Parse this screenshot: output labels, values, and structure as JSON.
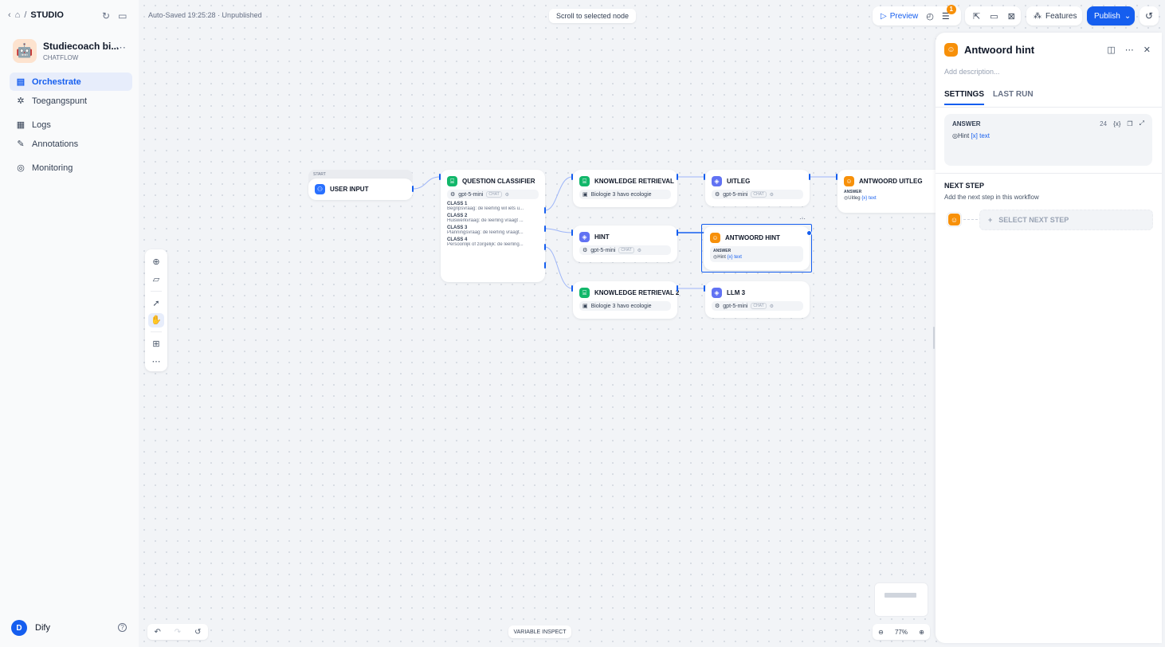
{
  "sidebar": {
    "breadcrumb": {
      "separator": "/",
      "studio": "STUDIO"
    },
    "app": {
      "name": "Studiecoach bi...",
      "type": "CHATFLOW",
      "avatar": "🤖"
    },
    "nav": [
      {
        "label": "Orchestrate",
        "icon": "orchestrate-icon",
        "active": true
      },
      {
        "label": "Toegangspunt",
        "icon": "access-point-icon"
      },
      {
        "label": "Logs",
        "icon": "logs-icon"
      },
      {
        "label": "Annotations",
        "icon": "annotations-icon"
      },
      {
        "label": "Monitoring",
        "icon": "monitoring-icon"
      }
    ],
    "account": {
      "initial": "D",
      "name": "Dify"
    }
  },
  "header": {
    "autosave": "Auto-Saved 19:25:28 · Unpublished",
    "scroll_to_selected": "Scroll to selected node",
    "preview": "Preview",
    "checklist_badge": "1",
    "features": "Features",
    "publish": "Publish"
  },
  "nodes": {
    "start_tag": "START",
    "user_input": {
      "title": "USER INPUT"
    },
    "classifier": {
      "title": "QUESTION CLASSIFIER",
      "model": "gpt-5-mini",
      "mode": "CHAT",
      "classes": [
        {
          "label": "CLASS 1",
          "text": "Begripsvraag: de leerling wil iets u..."
        },
        {
          "label": "CLASS 2",
          "text": "Huiswerkvraag: de leerling vraagt ..."
        },
        {
          "label": "CLASS 3",
          "text": "Planningsvraag: de leerling vraagt..."
        },
        {
          "label": "CLASS 4",
          "text": "Persoonlijk of zorgelijk: de leerling..."
        }
      ]
    },
    "knowledge1": {
      "title": "KNOWLEDGE RETRIEVAL",
      "dataset": "Biologie 3 havo ecologie"
    },
    "uitleg": {
      "title": "UITLEG",
      "model": "gpt-5-mini",
      "mode": "CHAT"
    },
    "antwoord_uitleg": {
      "title": "ANTWOORD UITLEG",
      "answer_label": "ANSWER",
      "var_node": "Uitleg",
      "var_name": "{x} text"
    },
    "hint": {
      "title": "HINT",
      "model": "gpt-5-mini",
      "mode": "CHAT"
    },
    "antwoord_hint": {
      "title": "ANTWOORD HINT",
      "answer_label": "ANSWER",
      "var_node": "Hint",
      "var_name": "{x} text"
    },
    "knowledge2": {
      "title": "KNOWLEDGE RETRIEVAL 2",
      "dataset": "Biologie 3 havo ecologie"
    },
    "llm3": {
      "title": "LLM 3",
      "model": "gpt-5-mini",
      "mode": "CHAT"
    }
  },
  "canvas": {
    "variable_inspect": "VARIABLE INSPECT",
    "zoom": "77%"
  },
  "panel": {
    "title": "Antwoord hint",
    "description_placeholder": "Add description...",
    "tabs": [
      "SETTINGS",
      "LAST RUN"
    ],
    "answer": {
      "label": "ANSWER",
      "count": "24",
      "var_button": "{x}",
      "var_node": "Hint",
      "var_name": "[x] text"
    },
    "next_step": {
      "title": "NEXT STEP",
      "description": "Add the next step in this workflow",
      "button": "SELECT NEXT STEP"
    }
  },
  "colors": {
    "accent": "#155eef",
    "answer_node": "#f79009",
    "knowledge_node": "#12b76a",
    "llm_node": "#6172f3"
  }
}
